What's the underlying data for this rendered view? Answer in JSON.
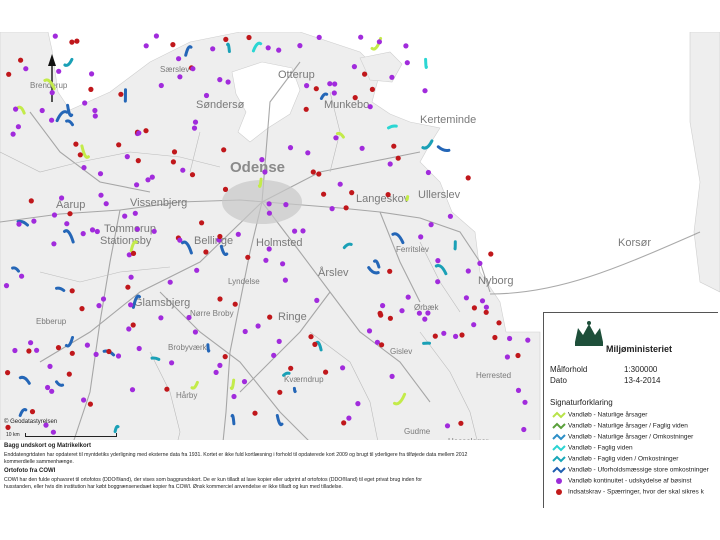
{
  "map": {
    "places": [
      {
        "name": "Særslev"
      },
      {
        "name": "Otterup"
      },
      {
        "name": "Søndersø"
      },
      {
        "name": "Munkebo"
      },
      {
        "name": "Kerteminde"
      },
      {
        "name": "Odense"
      },
      {
        "name": "Vissenbjerg"
      },
      {
        "name": "Aarup"
      },
      {
        "name": "Langeskov"
      },
      {
        "name": "Ullerslev"
      },
      {
        "name": "Tommerup"
      },
      {
        "name": "Stationsby"
      },
      {
        "name": "Bellinge"
      },
      {
        "name": "Holmsted"
      },
      {
        "name": "Årslev"
      },
      {
        "name": "Ferritslev"
      },
      {
        "name": "Nyborg"
      },
      {
        "name": "Korsør"
      },
      {
        "name": "Ebberup"
      },
      {
        "name": "Glamsbjerg"
      },
      {
        "name": "Lyndelse"
      },
      {
        "name": "Ringe"
      },
      {
        "name": "Ørbæk"
      },
      {
        "name": "Nørre Broby"
      },
      {
        "name": "Brobyværk"
      },
      {
        "name": "Gislev"
      },
      {
        "name": "Kværndrup"
      },
      {
        "name": "Hårby"
      },
      {
        "name": "Herrested"
      },
      {
        "name": "Gudme"
      },
      {
        "name": "Hesselager"
      },
      {
        "name": "Brenderup"
      },
      {
        "name": "Tommerup"
      }
    ],
    "scale_label": "10 km",
    "copyright": "© Geodatastyrelsen"
  },
  "credits": [
    "Bagg undskort og Matrikelkort",
    "Enddatengrtdaten har opdateret til myntdetiks yderligning med eksterne data fra 1931. Kortet er ikke fuld kortlæsning i forhold til opdaterede kort 2009 og brugt til yderligere fra tilføjede data mellem 2012",
    "kommerdielle sammenhænge.",
    "Ortofoto fra COWI",
    "COWI har den fulde ophavsret til ortofotos (DDO®land), der vises som baggrundskort. De er kun tilladt at lave kopier eller udprint af ortofotos (DDO®land) til eget privat brug inden for",
    "husstanden, eller hvis din institution har købt boggrænsenedsæt kopier fra COWI. Ønsk kommerciel anvendelse er ikke tilladt og kun med tilladelse."
  ],
  "legend": {
    "ministry": "Miljøministeriet",
    "scale_key": "Målforhold",
    "scale_value": "1:300000",
    "date_key": "Dato",
    "date_value": "13-4-2014",
    "title": "Signaturforklaring",
    "items": [
      {
        "label": "Vandløb - Naturlige årsager",
        "color": "#b8e34a",
        "kind": "line"
      },
      {
        "label": "Vandløb - Naturlige årsager / Faglig viden",
        "color": "#5aa03c",
        "kind": "line"
      },
      {
        "label": "Vandløb - Naturlige årsager / Omkostninger",
        "color": "#2e8fc7",
        "kind": "line"
      },
      {
        "label": "Vandløb - Faglig viden",
        "color": "#2bd4d2",
        "kind": "line"
      },
      {
        "label": "Vandløb - Faglig viden / Omkostninger",
        "color": "#18a6b8",
        "kind": "line"
      },
      {
        "label": "Vandløb - Uforholdsmæssige store omkostninger",
        "color": "#1f5fb0",
        "kind": "line"
      },
      {
        "label": "Vandløb kontinuitet - udskydelse af bøsinst",
        "color": "#9b2dd8",
        "kind": "dot"
      },
      {
        "label": "Indsatskrav - Spærringer, hvor der skal sikres k",
        "color": "#c21a1a",
        "kind": "dot"
      }
    ]
  },
  "colors": {
    "purple": "#a12bdc",
    "red": "#c0171b",
    "blue": "#2466b7",
    "cyan": "#2bd6d3",
    "lime": "#c3eb4a",
    "teal": "#1aa0b6",
    "road": "#9a9a9a",
    "water": "#ffffff",
    "land": "#eeeeee"
  }
}
